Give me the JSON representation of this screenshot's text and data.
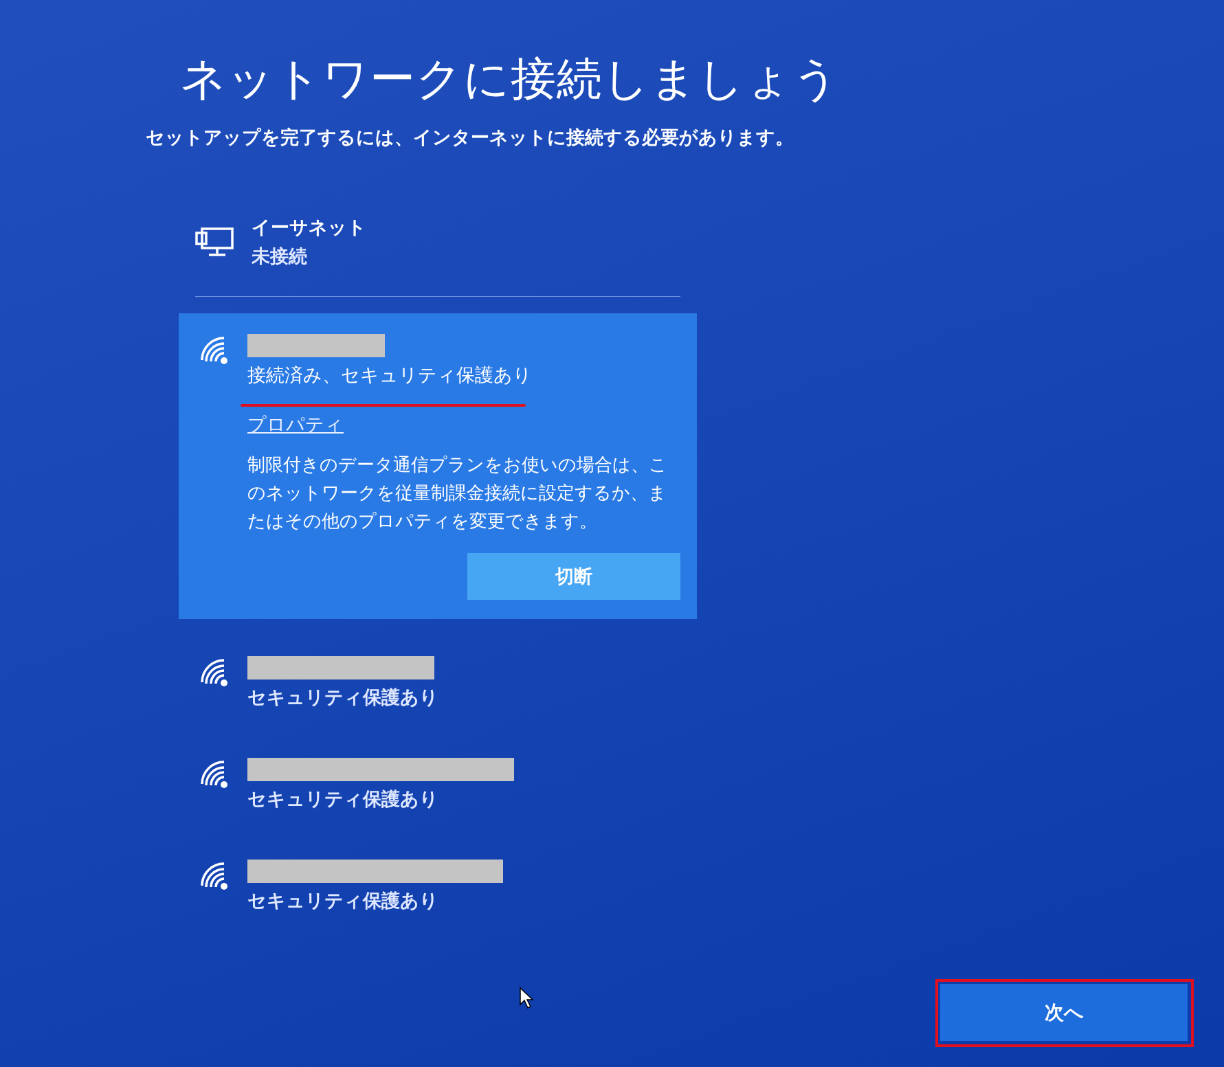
{
  "title": "ネットワークに接続しましょう",
  "subtitle": "セットアップを完了するには、インターネットに接続する必要があります。",
  "ethernet": {
    "name": "イーサネット",
    "status": "未接続"
  },
  "networks": [
    {
      "selected": true,
      "status": "接続済み、セキュリティ保護あり",
      "properties_link": "プロパティ",
      "description": "制限付きのデータ通信プランをお使いの場合は、このネットワークを従量制課金接続に設定するか、またはその他のプロパティを変更できます。",
      "button": "切断"
    },
    {
      "selected": false,
      "status": "セキュリティ保護あり"
    },
    {
      "selected": false,
      "status": "セキュリティ保護あり"
    },
    {
      "selected": false,
      "status": "セキュリティ保護あり"
    }
  ],
  "next_button": "次へ"
}
